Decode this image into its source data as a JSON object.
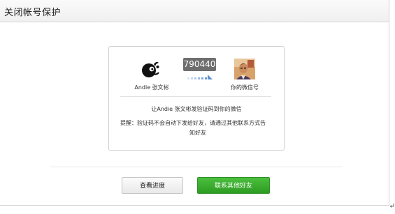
{
  "title": "关闭帐号保护",
  "left_user": {
    "name": "Andie 张文彬"
  },
  "code": "790440",
  "right_user": {
    "label": "你的微信号"
  },
  "send_text": "让Andie 张文彬发验证码到你的微信",
  "tip": {
    "line1": "提醒：验证码不会自动下发给好友，请通过其他联系方式告",
    "line2": "知好友"
  },
  "buttons": {
    "progress": "查看进度",
    "contact": "联系其他好友"
  },
  "colors": {
    "accent_green": "#36a82b",
    "code_badge": "#6e6e6e",
    "arrow_blue": "#5b8fd0"
  },
  "icons": {
    "left_avatar": "black-cartoon-avatar",
    "arrow": "transfer-arrow-icon",
    "return": "return-mark-icon"
  }
}
